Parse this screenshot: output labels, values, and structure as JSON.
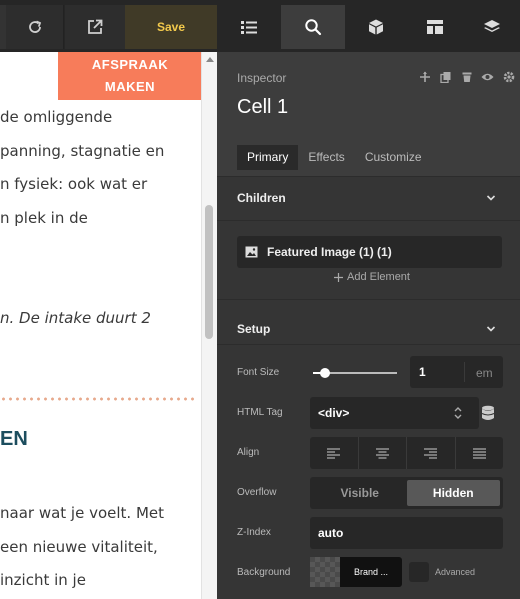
{
  "toolbar": {
    "save_label": "Save"
  },
  "preview": {
    "cta_line1": "AFSPRAAK",
    "cta_line2": "MAKEN",
    "lines": [
      "de omliggende",
      "panning, stagnatie en",
      "n fysiek: ook wat er",
      "n plek in de"
    ],
    "italic_line": "n. De intake duurt 2",
    "heading_fragment": "EN",
    "lines2": [
      "naar wat je voelt. Met",
      "een nieuwe vitaliteit,",
      "inzicht in je"
    ]
  },
  "panel": {
    "nav_icons": [
      "structure-icon",
      "search-icon",
      "cube-icon",
      "layout-icon",
      "layers-icon"
    ],
    "inspector_label": "Inspector",
    "element_title": "Cell 1",
    "tabs": [
      "Primary",
      "Effects",
      "Customize"
    ],
    "children": {
      "title": "Children",
      "item_label": "Featured Image (1) (1)",
      "add_label": "Add Element"
    },
    "setup": {
      "title": "Setup",
      "font_size_label": "Font Size",
      "font_size_value": "1",
      "font_size_unit": "em",
      "html_tag_label": "HTML Tag",
      "html_tag_value": "<div>",
      "align_label": "Align",
      "overflow_label": "Overflow",
      "overflow_options": [
        "Visible",
        "Hidden"
      ],
      "overflow_selected": "Hidden",
      "zindex_label": "Z-Index",
      "zindex_value": "auto",
      "background_label": "Background",
      "background_brand": "Brand ...",
      "advanced_label": "Advanced"
    }
  },
  "colors": {
    "cta": "#f77c5a",
    "save_text": "#f2c94c",
    "heading": "#1c4d5e",
    "panel_bg": "#3d3d3d"
  }
}
